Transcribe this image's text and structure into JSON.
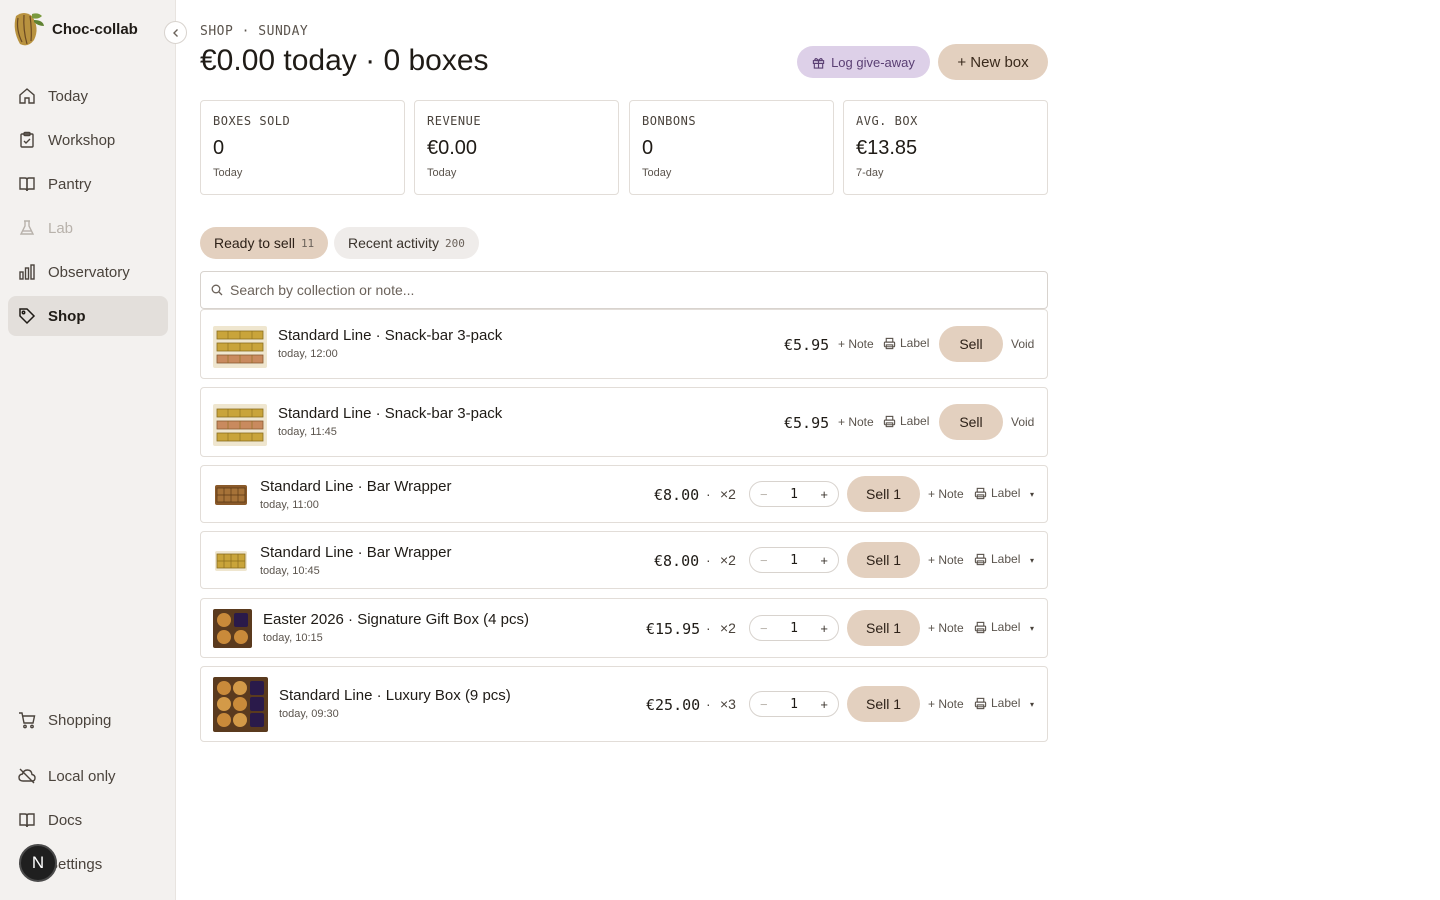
{
  "app": {
    "name": "Choc-collab"
  },
  "sidebar": {
    "items": [
      {
        "label": "Today",
        "icon": "home-icon"
      },
      {
        "label": "Workshop",
        "icon": "clipboard-icon"
      },
      {
        "label": "Pantry",
        "icon": "book-icon"
      },
      {
        "label": "Lab",
        "icon": "flask-icon",
        "disabled": true
      },
      {
        "label": "Observatory",
        "icon": "bar-chart-icon"
      },
      {
        "label": "Shop",
        "icon": "tag-icon",
        "active": true
      }
    ],
    "bottom": [
      {
        "label": "Shopping",
        "icon": "cart-icon"
      },
      {
        "label": "Local only",
        "icon": "cloud-off-icon"
      },
      {
        "label": "Docs",
        "icon": "book-icon"
      },
      {
        "label": "Settings",
        "icon": "gear-icon"
      }
    ],
    "user_initial": "N"
  },
  "header": {
    "crumb": "SHOP · SUNDAY",
    "title": "€0.00 today · 0 boxes",
    "giveaway_label": "Log give-away",
    "new_box_label": "+ New box"
  },
  "stats": [
    {
      "label": "BOXES SOLD",
      "value": "0",
      "sub": "Today"
    },
    {
      "label": "REVENUE",
      "value": "€0.00",
      "sub": "Today"
    },
    {
      "label": "BONBONS",
      "value": "0",
      "sub": "Today"
    },
    {
      "label": "AVG. BOX",
      "value": "€13.85",
      "sub": "7-day"
    }
  ],
  "tabs": [
    {
      "label": "Ready to sell",
      "count": "11",
      "active": true
    },
    {
      "label": "Recent activity",
      "count": "200",
      "active": false
    }
  ],
  "search": {
    "placeholder": "Search by collection or note..."
  },
  "rows": [
    {
      "title": "Standard Line · Snack-bar 3-pack",
      "time": "today, 12:00",
      "price": "€5.95",
      "note": "+ Note",
      "label": "Label",
      "sell": "Sell",
      "void": "Void"
    },
    {
      "title": "Standard Line · Snack-bar 3-pack",
      "time": "today, 11:45",
      "price": "€5.95",
      "note": "+ Note",
      "label": "Label",
      "sell": "Sell",
      "void": "Void"
    },
    {
      "title": "Standard Line · Bar Wrapper",
      "time": "today, 11:00",
      "price": "€8.00",
      "sep": "·",
      "mult": "×2",
      "qty": "1",
      "minus": "−",
      "plus": "+",
      "note": "+ Note",
      "label": "Label",
      "sell": "Sell 1",
      "caret": "▾"
    },
    {
      "title": "Standard Line · Bar Wrapper",
      "time": "today, 10:45",
      "price": "€8.00",
      "sep": "·",
      "mult": "×2",
      "qty": "1",
      "minus": "−",
      "plus": "+",
      "note": "+ Note",
      "label": "Label",
      "sell": "Sell 1",
      "caret": "▾"
    },
    {
      "title": "Easter 2026 · Signature Gift Box (4 pcs)",
      "time": "today, 10:15",
      "price": "€15.95",
      "sep": "·",
      "mult": "×2",
      "qty": "1",
      "minus": "−",
      "plus": "+",
      "note": "+ Note",
      "label": "Label",
      "sell": "Sell 1",
      "caret": "▾"
    },
    {
      "title": "Standard Line · Luxury Box (9 pcs)",
      "time": "today, 09:30",
      "price": "€25.00",
      "sep": "·",
      "mult": "×3",
      "qty": "1",
      "minus": "−",
      "plus": "+",
      "note": "+ Note",
      "label": "Label",
      "sell": "Sell 1",
      "caret": "▾"
    }
  ],
  "colors": {
    "accent": "#e3d0bf",
    "giveaway_bg": "#ddd0e8",
    "sidebar_bg": "#f3f1ef"
  }
}
